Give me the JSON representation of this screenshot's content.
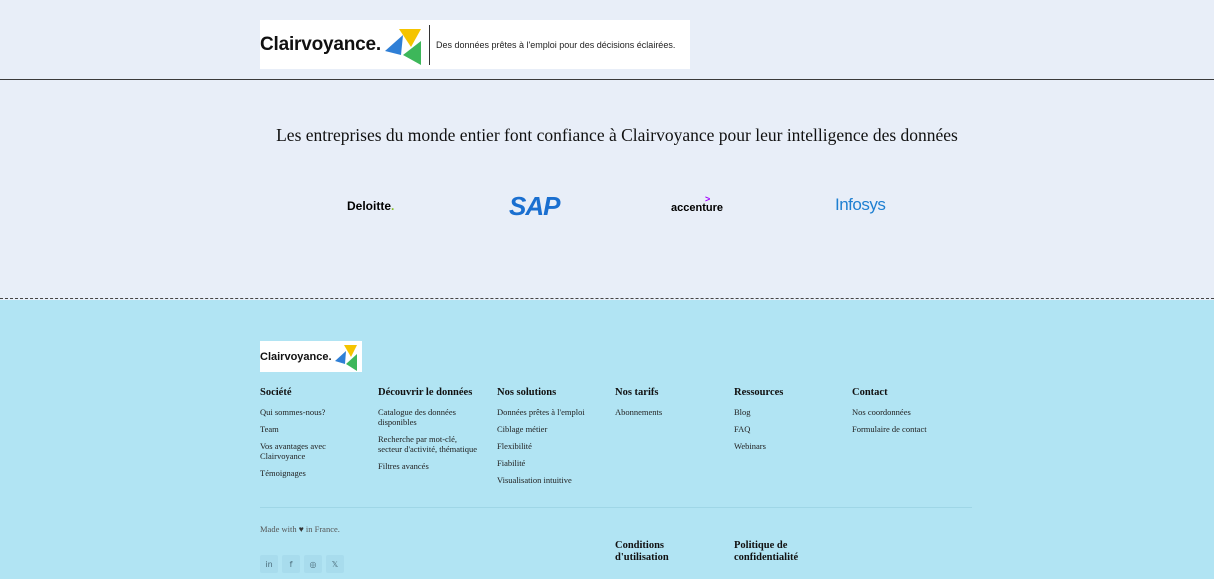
{
  "header": {
    "brand": "Clairvoyance.",
    "tagline": "Des données prêtes à l'emploi pour des décisions éclairées."
  },
  "trust": {
    "title": "Les entreprises du monde entier font confiance à Clairvoyance pour leur intelligence des données",
    "logos": {
      "deloitte": "Deloitte",
      "deloitte_dot": ".",
      "sap": "SAP",
      "accenture": "accenture",
      "infosys": "Infosys"
    }
  },
  "footer": {
    "brand": "Clairvoyance.",
    "columns": [
      {
        "title": "Société",
        "items": [
          "Qui sommes-nous?",
          "Team",
          "Vos avantages avec Clairvoyance",
          "Témoignages"
        ]
      },
      {
        "title": "Découvrir le données",
        "items": [
          "Catalogue des données disponibles",
          "Recherche par mot-clé, secteur d'activité, thématique",
          "Filtres avancés"
        ]
      },
      {
        "title": "Nos solutions",
        "items": [
          "Données prêtes à l'emploi",
          "Ciblage métier",
          "Flexibilité",
          "Fiabilité",
          "Visualisation intuitive"
        ]
      },
      {
        "title": "Nos tarifs",
        "items": [
          "Abonnements"
        ]
      },
      {
        "title": "Ressources",
        "items": [
          "Blog",
          "FAQ",
          "Webinars"
        ]
      },
      {
        "title": "Contact",
        "items": [
          "Nos coordonnées",
          "Formulaire de contact"
        ]
      }
    ],
    "made_with_prefix": "Made with",
    "made_with_suffix": "in France.",
    "socials": [
      "linkedin-icon",
      "facebook-icon",
      "instagram-icon",
      "x-icon"
    ],
    "legal": {
      "terms": "Conditions d'utilisation",
      "privacy": "Politique de confidentialité"
    }
  },
  "colors": {
    "page_bg": "#e8eef8",
    "footer_bg": "#b1e4f3",
    "brand_blue": "#2f7fd6",
    "brand_yellow": "#f5c400",
    "brand_green": "#3db75a"
  }
}
